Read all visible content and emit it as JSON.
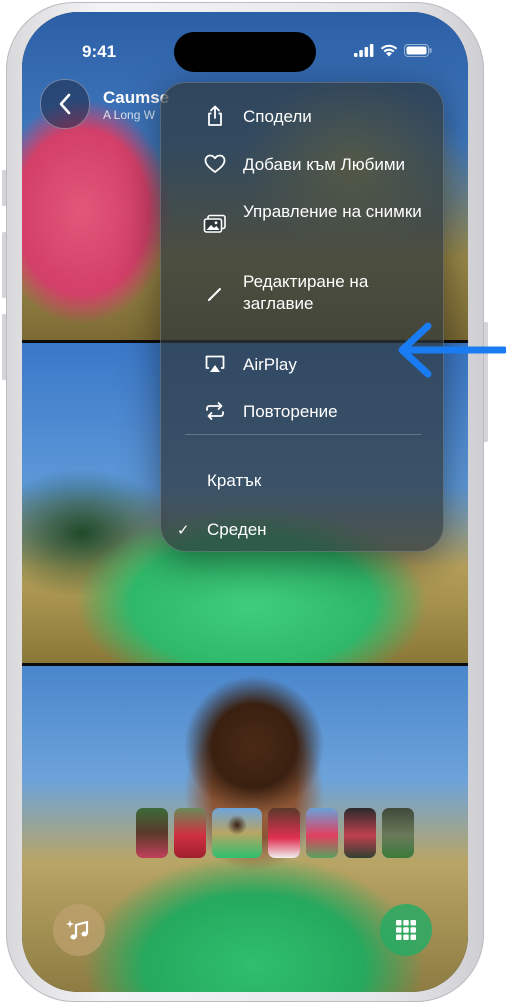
{
  "status_bar": {
    "time": "9:41"
  },
  "header": {
    "title": "Caumse",
    "subtitle": "A Long W"
  },
  "menu": {
    "items": [
      {
        "label": "Сподели",
        "icon": "share-icon"
      },
      {
        "label": "Добави към Любими",
        "icon": "heart-icon"
      },
      {
        "label": "Управление на снимки",
        "icon": "photos-icon"
      },
      {
        "label": "Редактиране на заглавие",
        "icon": "pencil-icon"
      },
      {
        "label": "AirPlay",
        "icon": "airplay-icon"
      },
      {
        "label": "Повторение",
        "icon": "repeat-icon"
      }
    ],
    "options": [
      {
        "label": "Кратък",
        "selected": false
      },
      {
        "label": "Среден",
        "selected": true
      }
    ],
    "check_mark": "✓"
  },
  "colors": {
    "callout_arrow": "#1a7cf2",
    "menu_text": "#ffffff"
  }
}
